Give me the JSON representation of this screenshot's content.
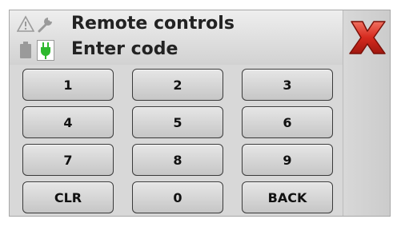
{
  "header": {
    "title": "Remote controls",
    "subtitle": "Enter code",
    "icons": [
      "warning-icon",
      "wrench-icon",
      "battery-icon",
      "power-plug-icon"
    ]
  },
  "keypad": {
    "keys": [
      "1",
      "2",
      "3",
      "4",
      "5",
      "6",
      "7",
      "8",
      "9",
      "CLR",
      "0",
      "BACK"
    ]
  },
  "close_button": {
    "icon": "close-x-icon",
    "color": "#d62a1e"
  },
  "colors": {
    "plug_active": "#2db82d",
    "background": "#dcdcdc"
  }
}
